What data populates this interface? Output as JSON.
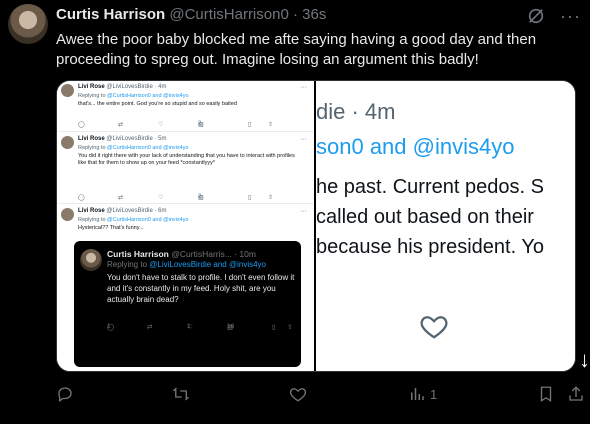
{
  "tweet": {
    "name": "Curtis Harrison",
    "handle": "@CurtisHarrison0",
    "time": "· 36s",
    "text": "Awee the poor baby blocked me afte saying having a good day and then proceeding to spreg out. Imagine losing an argument this badly!",
    "views": "1"
  },
  "left_screenshot": {
    "replies": [
      {
        "name": "Livi Rose",
        "meta": "@LiviLovesBirdie · 4m",
        "replying_prefix": "Replying to ",
        "replying_to": "@CurtisHarrison0 and @invis4yo",
        "text": "that's... the entire point. God you're so stupid and so easily baited",
        "views": "2"
      },
      {
        "name": "Livi Rose",
        "meta": "@LiviLovesBirdie · 5m",
        "replying_prefix": "Replying to ",
        "replying_to": "@CurtisHarrison0 and @invis4yo",
        "text": "You did it right there with your lack of understanding that you have to interact with profiles like that for them to show up on your feed *constantlyyy*",
        "views": "2"
      },
      {
        "name": "Livi Rose",
        "meta": "@LiviLovesBirdie · 6m",
        "replying_prefix": "Replying to ",
        "replying_to": "@CurtisHarrison0 and @invis4yo",
        "text": "Hysterical?? That's funny..."
      }
    ],
    "embedded": {
      "name": "Curtis Harrison",
      "meta": "@CurtisHarris... · 10m",
      "replying_prefix": "Replying to ",
      "replying_to": "@LiviLovesBirdie and @invis4yo",
      "text": "You don't have to stalk to profile. I don't even follow it and it's constantly in my feed. Holy shit, are you actually brain dead?",
      "replies": "1",
      "likes": "1",
      "views": "16"
    }
  },
  "right_screenshot": {
    "name_fragment": "die · 4m",
    "replying_fragment": "son0 and @invis4yo",
    "lines": [
      "he past. Current pedos. S",
      "called out based on their",
      "because his president. Yo"
    ]
  },
  "colors": {
    "background": "#000000",
    "text": "#e7e9ea",
    "muted": "#71767b",
    "link": "#1d9bf0"
  }
}
